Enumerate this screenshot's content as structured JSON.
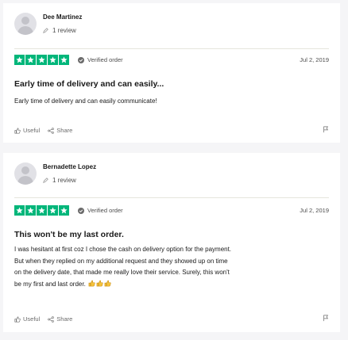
{
  "reviews": [
    {
      "reviewer_name": "Dee Martinez",
      "review_count": "1 review",
      "rating": 5,
      "verified_label": "Verified order",
      "date": "Jul 2, 2019",
      "title": "Early time of delivery and can easily...",
      "text": "Early time of delivery and can easily communicate!",
      "useful_label": "Useful",
      "share_label": "Share"
    },
    {
      "reviewer_name": "Bernadette Lopez",
      "review_count": "1 review",
      "rating": 5,
      "verified_label": "Verified order",
      "date": "Jul 2, 2019",
      "title": "This won't be my last order.",
      "text_lines": [
        "I was hesitant at first coz I chose the cash on delivery option for the payment.",
        "But when they replied on my additional request and they showed up on time",
        "on the delivery date, that made me really love their service. Surely, this won't",
        "be my first and last order."
      ],
      "emojis": [
        "thumbs-up-icon",
        "thumbs-up-icon",
        "thumbs-up-icon"
      ],
      "useful_label": "Useful",
      "share_label": "Share"
    }
  ],
  "colors": {
    "star_green": "#00b67a",
    "page_bg": "#f5f5f7",
    "card_bg": "#ffffff"
  }
}
